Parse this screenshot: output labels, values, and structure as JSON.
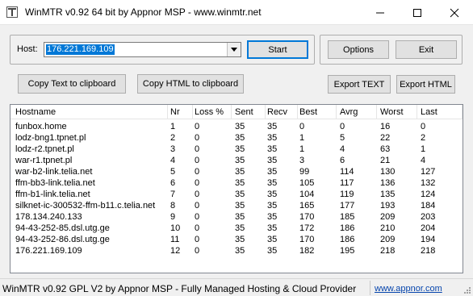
{
  "window": {
    "title": "WinMTR v0.92 64 bit by Appnor MSP - www.winmtr.net"
  },
  "host": {
    "label": "Host:",
    "value": "176.221.169.109"
  },
  "buttons": {
    "start": "Start",
    "options": "Options",
    "exit": "Exit",
    "copy_text": "Copy Text to clipboard",
    "copy_html": "Copy HTML to clipboard",
    "export_text": "Export TEXT",
    "export_html": "Export HTML"
  },
  "table": {
    "columns": [
      "Hostname",
      "Nr",
      "Loss %",
      "Sent",
      "Recv",
      "Best",
      "Avrg",
      "Worst",
      "Last"
    ],
    "rows": [
      [
        "funbox.home",
        "1",
        "0",
        "35",
        "35",
        "0",
        "0",
        "16",
        "0"
      ],
      [
        "lodz-bng1.tpnet.pl",
        "2",
        "0",
        "35",
        "35",
        "1",
        "5",
        "22",
        "2"
      ],
      [
        "lodz-r2.tpnet.pl",
        "3",
        "0",
        "35",
        "35",
        "1",
        "4",
        "63",
        "1"
      ],
      [
        "war-r1.tpnet.pl",
        "4",
        "0",
        "35",
        "35",
        "3",
        "6",
        "21",
        "4"
      ],
      [
        "war-b2-link.telia.net",
        "5",
        "0",
        "35",
        "35",
        "99",
        "114",
        "130",
        "127"
      ],
      [
        "ffm-bb3-link.telia.net",
        "6",
        "0",
        "35",
        "35",
        "105",
        "117",
        "136",
        "132"
      ],
      [
        "ffm-b1-link.telia.net",
        "7",
        "0",
        "35",
        "35",
        "104",
        "119",
        "135",
        "124"
      ],
      [
        "silknet-ic-300532-ffm-b11.c.telia.net",
        "8",
        "0",
        "35",
        "35",
        "165",
        "177",
        "193",
        "184"
      ],
      [
        "178.134.240.133",
        "9",
        "0",
        "35",
        "35",
        "170",
        "185",
        "209",
        "203"
      ],
      [
        "94-43-252-85.dsl.utg.ge",
        "10",
        "0",
        "35",
        "35",
        "172",
        "186",
        "210",
        "204"
      ],
      [
        "94-43-252-86.dsl.utg.ge",
        "11",
        "0",
        "35",
        "35",
        "170",
        "186",
        "209",
        "194"
      ],
      [
        "176.221.169.109",
        "12",
        "0",
        "35",
        "35",
        "182",
        "195",
        "218",
        "218"
      ]
    ]
  },
  "statusbar": {
    "text": "WinMTR v0.92 GPL V2 by Appnor MSP - Fully Managed Hosting & Cloud Provider",
    "link": "www.appnor.com"
  }
}
